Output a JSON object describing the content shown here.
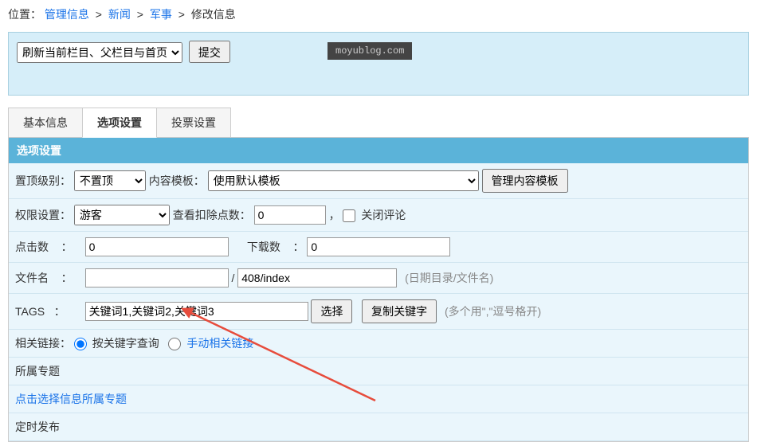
{
  "breadcrumb": {
    "prefix": "位置：",
    "items": [
      "管理信息",
      "新闻",
      "军事"
    ],
    "current": "修改信息"
  },
  "refresh": {
    "select_option": "刷新当前栏目、父栏目与首页",
    "submit": "提交"
  },
  "watermark": "moyublog.com",
  "tabs": [
    {
      "label": "基本信息",
      "active": false
    },
    {
      "label": "选项设置",
      "active": true
    },
    {
      "label": "投票设置",
      "active": false
    }
  ],
  "panel_title": "选项设置",
  "form": {
    "top_level": {
      "label": "置顶级别：",
      "value": "不置顶"
    },
    "content_tpl": {
      "label": "内容模板：",
      "value": "使用默认模板",
      "button": "管理内容模板"
    },
    "permission": {
      "label": "权限设置：",
      "value": "游客"
    },
    "deduct": {
      "label": "查看扣除点数：",
      "value": "0",
      "sep": "，"
    },
    "close_comment": {
      "label": "关闭评论"
    },
    "clicks": {
      "label": "点击数",
      "value": "0"
    },
    "downloads": {
      "label": "下载数",
      "value": "0"
    },
    "filename": {
      "label": "文件名",
      "value1": "",
      "sep": "/",
      "value2": "408/index",
      "hint": "(日期目录/文件名)"
    },
    "tags": {
      "label": "TAGS",
      "value": "关键词1,关键词2,关键词3",
      "select_btn": "选择",
      "copy_btn": "复制关键字",
      "hint": "(多个用\",\"逗号格开)"
    },
    "related": {
      "label": "相关链接：",
      "opt1": "按关键字查询",
      "opt2": "手动相关链接"
    },
    "special": {
      "label": "所属专题"
    },
    "special_link": "点击选择信息所属专题",
    "schedule": {
      "label": "定时发布"
    }
  },
  "colon": "："
}
